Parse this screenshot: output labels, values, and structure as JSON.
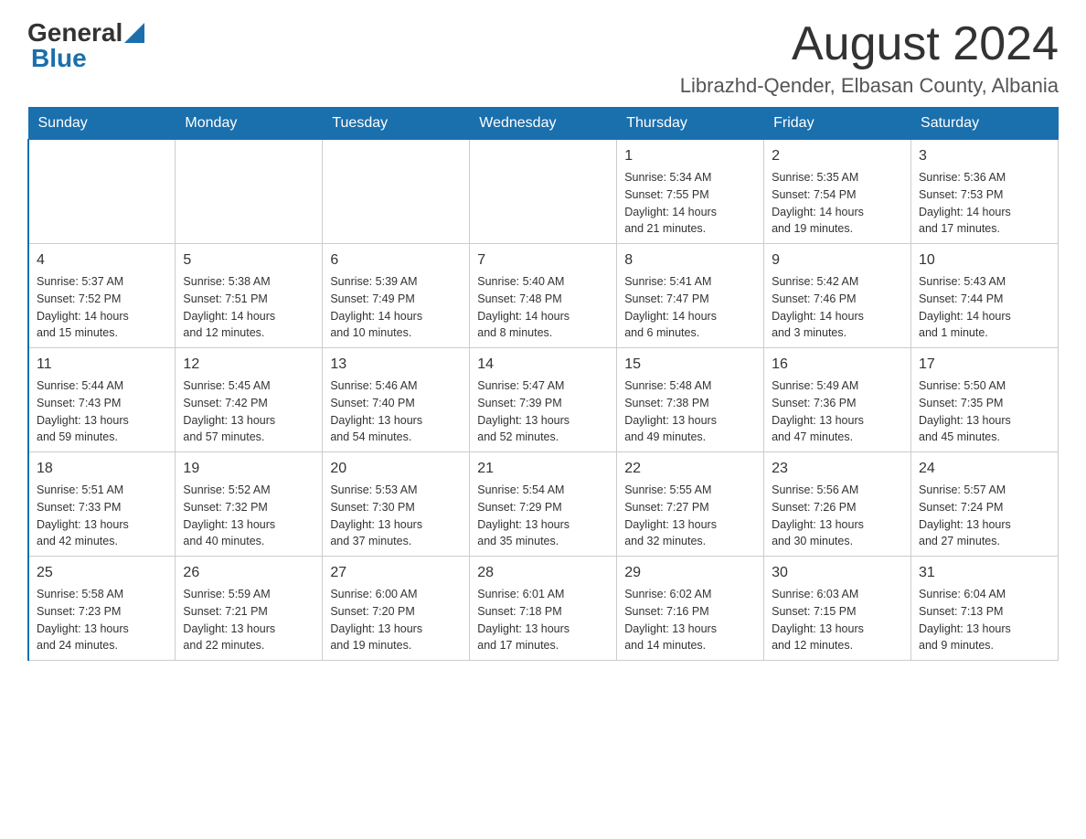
{
  "header": {
    "logo_general": "General",
    "logo_blue": "Blue",
    "month_title": "August 2024",
    "location": "Librazhd-Qender, Elbasan County, Albania"
  },
  "weekdays": [
    "Sunday",
    "Monday",
    "Tuesday",
    "Wednesday",
    "Thursday",
    "Friday",
    "Saturday"
  ],
  "weeks": [
    [
      {
        "day": "",
        "info": ""
      },
      {
        "day": "",
        "info": ""
      },
      {
        "day": "",
        "info": ""
      },
      {
        "day": "",
        "info": ""
      },
      {
        "day": "1",
        "info": "Sunrise: 5:34 AM\nSunset: 7:55 PM\nDaylight: 14 hours\nand 21 minutes."
      },
      {
        "day": "2",
        "info": "Sunrise: 5:35 AM\nSunset: 7:54 PM\nDaylight: 14 hours\nand 19 minutes."
      },
      {
        "day": "3",
        "info": "Sunrise: 5:36 AM\nSunset: 7:53 PM\nDaylight: 14 hours\nand 17 minutes."
      }
    ],
    [
      {
        "day": "4",
        "info": "Sunrise: 5:37 AM\nSunset: 7:52 PM\nDaylight: 14 hours\nand 15 minutes."
      },
      {
        "day": "5",
        "info": "Sunrise: 5:38 AM\nSunset: 7:51 PM\nDaylight: 14 hours\nand 12 minutes."
      },
      {
        "day": "6",
        "info": "Sunrise: 5:39 AM\nSunset: 7:49 PM\nDaylight: 14 hours\nand 10 minutes."
      },
      {
        "day": "7",
        "info": "Sunrise: 5:40 AM\nSunset: 7:48 PM\nDaylight: 14 hours\nand 8 minutes."
      },
      {
        "day": "8",
        "info": "Sunrise: 5:41 AM\nSunset: 7:47 PM\nDaylight: 14 hours\nand 6 minutes."
      },
      {
        "day": "9",
        "info": "Sunrise: 5:42 AM\nSunset: 7:46 PM\nDaylight: 14 hours\nand 3 minutes."
      },
      {
        "day": "10",
        "info": "Sunrise: 5:43 AM\nSunset: 7:44 PM\nDaylight: 14 hours\nand 1 minute."
      }
    ],
    [
      {
        "day": "11",
        "info": "Sunrise: 5:44 AM\nSunset: 7:43 PM\nDaylight: 13 hours\nand 59 minutes."
      },
      {
        "day": "12",
        "info": "Sunrise: 5:45 AM\nSunset: 7:42 PM\nDaylight: 13 hours\nand 57 minutes."
      },
      {
        "day": "13",
        "info": "Sunrise: 5:46 AM\nSunset: 7:40 PM\nDaylight: 13 hours\nand 54 minutes."
      },
      {
        "day": "14",
        "info": "Sunrise: 5:47 AM\nSunset: 7:39 PM\nDaylight: 13 hours\nand 52 minutes."
      },
      {
        "day": "15",
        "info": "Sunrise: 5:48 AM\nSunset: 7:38 PM\nDaylight: 13 hours\nand 49 minutes."
      },
      {
        "day": "16",
        "info": "Sunrise: 5:49 AM\nSunset: 7:36 PM\nDaylight: 13 hours\nand 47 minutes."
      },
      {
        "day": "17",
        "info": "Sunrise: 5:50 AM\nSunset: 7:35 PM\nDaylight: 13 hours\nand 45 minutes."
      }
    ],
    [
      {
        "day": "18",
        "info": "Sunrise: 5:51 AM\nSunset: 7:33 PM\nDaylight: 13 hours\nand 42 minutes."
      },
      {
        "day": "19",
        "info": "Sunrise: 5:52 AM\nSunset: 7:32 PM\nDaylight: 13 hours\nand 40 minutes."
      },
      {
        "day": "20",
        "info": "Sunrise: 5:53 AM\nSunset: 7:30 PM\nDaylight: 13 hours\nand 37 minutes."
      },
      {
        "day": "21",
        "info": "Sunrise: 5:54 AM\nSunset: 7:29 PM\nDaylight: 13 hours\nand 35 minutes."
      },
      {
        "day": "22",
        "info": "Sunrise: 5:55 AM\nSunset: 7:27 PM\nDaylight: 13 hours\nand 32 minutes."
      },
      {
        "day": "23",
        "info": "Sunrise: 5:56 AM\nSunset: 7:26 PM\nDaylight: 13 hours\nand 30 minutes."
      },
      {
        "day": "24",
        "info": "Sunrise: 5:57 AM\nSunset: 7:24 PM\nDaylight: 13 hours\nand 27 minutes."
      }
    ],
    [
      {
        "day": "25",
        "info": "Sunrise: 5:58 AM\nSunset: 7:23 PM\nDaylight: 13 hours\nand 24 minutes."
      },
      {
        "day": "26",
        "info": "Sunrise: 5:59 AM\nSunset: 7:21 PM\nDaylight: 13 hours\nand 22 minutes."
      },
      {
        "day": "27",
        "info": "Sunrise: 6:00 AM\nSunset: 7:20 PM\nDaylight: 13 hours\nand 19 minutes."
      },
      {
        "day": "28",
        "info": "Sunrise: 6:01 AM\nSunset: 7:18 PM\nDaylight: 13 hours\nand 17 minutes."
      },
      {
        "day": "29",
        "info": "Sunrise: 6:02 AM\nSunset: 7:16 PM\nDaylight: 13 hours\nand 14 minutes."
      },
      {
        "day": "30",
        "info": "Sunrise: 6:03 AM\nSunset: 7:15 PM\nDaylight: 13 hours\nand 12 minutes."
      },
      {
        "day": "31",
        "info": "Sunrise: 6:04 AM\nSunset: 7:13 PM\nDaylight: 13 hours\nand 9 minutes."
      }
    ]
  ]
}
